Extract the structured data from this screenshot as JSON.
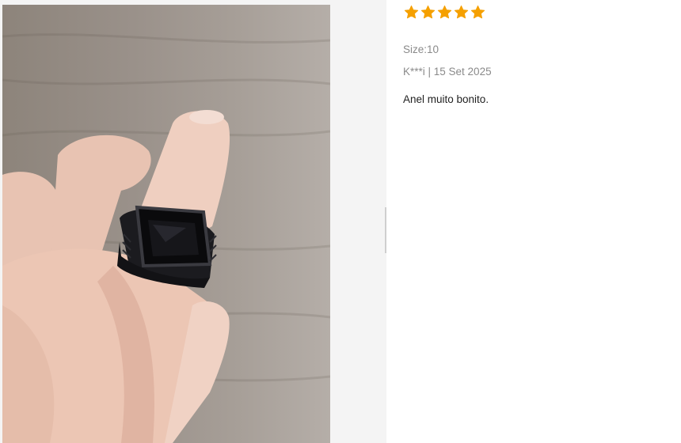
{
  "review": {
    "rating": 5,
    "max_rating": 5,
    "star_color": "#f5a000",
    "size_text": "Size:10",
    "author_date": "K***i | 15 Set 2025",
    "body": "Anel muito bonito."
  },
  "photo": {
    "icon": "review-photo-ring-on-finger"
  }
}
